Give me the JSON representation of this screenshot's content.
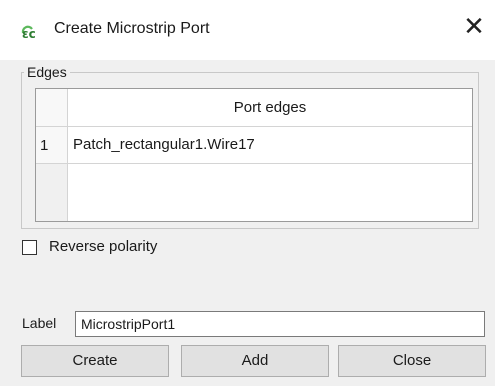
{
  "window": {
    "title": "Create Microstrip Port",
    "icon": "fc-logo-icon",
    "close_glyph": "✕"
  },
  "edges_group": {
    "title": "Edges",
    "table": {
      "header": "Port edges",
      "rows": [
        {
          "num": "1",
          "value": "Patch_rectangular1.Wire17"
        }
      ]
    }
  },
  "reverse_polarity": {
    "label": "Reverse polarity",
    "checked": false
  },
  "label_field": {
    "caption": "Label",
    "value": "MicrostripPort1"
  },
  "buttons": {
    "create": "Create",
    "add": "Add",
    "close": "Close"
  },
  "colors": {
    "accent_green": "#3a9a3a",
    "dialog_bg": "#f0f0f0"
  }
}
